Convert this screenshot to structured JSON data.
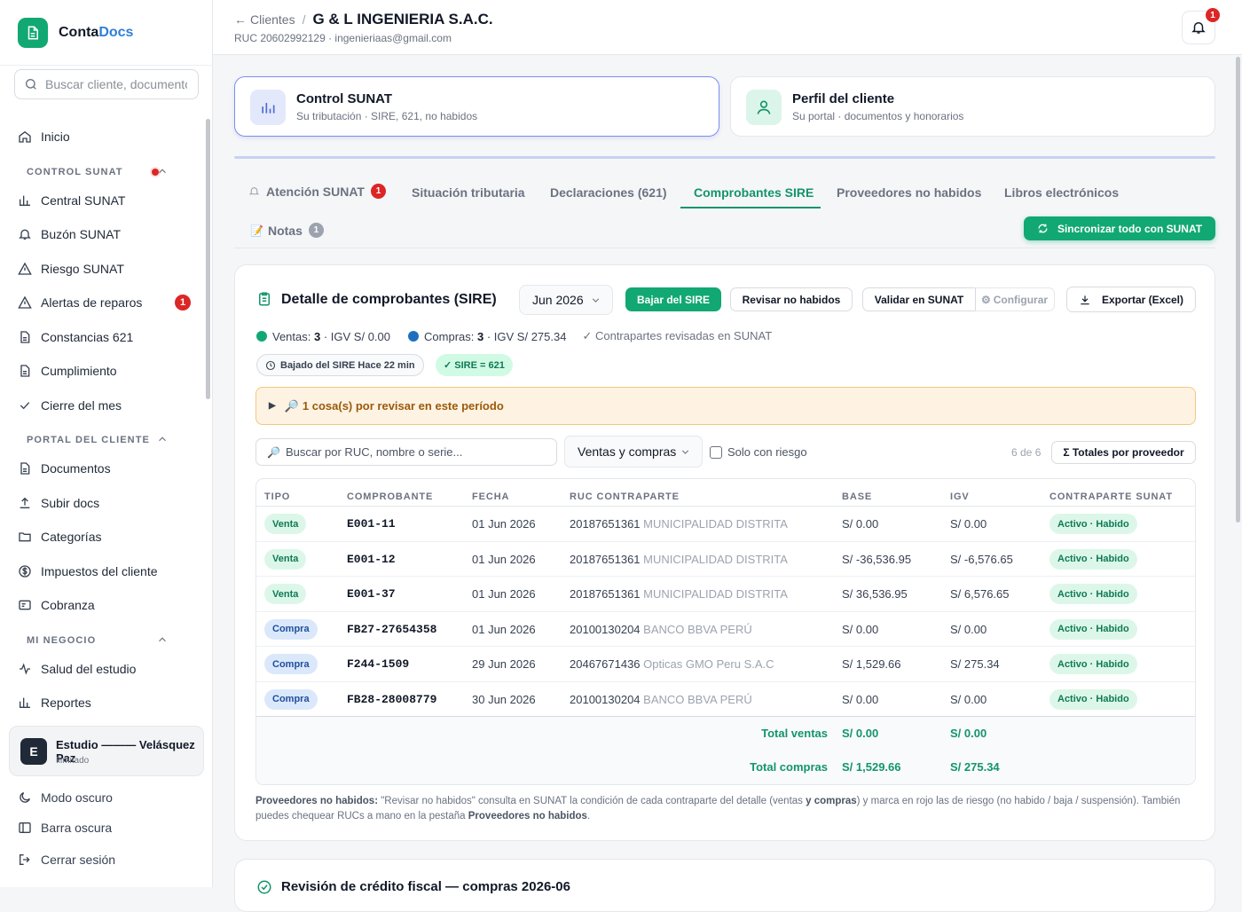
{
  "brand": {
    "name_part1": "Conta",
    "name_part2": "Docs"
  },
  "sidebar": {
    "search_placeholder": "Buscar cliente, documento...",
    "home": "Inicio",
    "section_sunat": "CONTROL SUNAT",
    "sunat_items": [
      "Central SUNAT",
      "Buzón SUNAT",
      "Riesgo SUNAT",
      "Alertas de reparos",
      "Constancias 621",
      "Cumplimiento",
      "Cierre del mes"
    ],
    "alertas_badge": "1",
    "section_portal": "PORTAL DEL CLIENTE",
    "portal_items": [
      "Documentos",
      "Subir docs",
      "Categorías",
      "Impuestos del cliente",
      "Cobranza"
    ],
    "section_negocio": "MI NEGOCIO",
    "negocio_items": [
      "Salud del estudio",
      "Reportes"
    ],
    "studio_initial": "E",
    "studio_name": "Estudio ——— Velásquez Paz",
    "studio_plan": "Ilimitado",
    "footer": [
      "Modo oscuro",
      "Barra oscura",
      "Cerrar sesión"
    ]
  },
  "header": {
    "back_label": "Clientes",
    "client_name": "G & L INGENIERIA S.A.C.",
    "subtitle": "RUC 20602992129 · ingenieriaas@gmail.com",
    "notif_count": "1"
  },
  "cards": [
    {
      "title": "Control SUNAT",
      "subtitle": "Su tributación · SIRE, 621, no habidos"
    },
    {
      "title": "Perfil del cliente",
      "subtitle": "Su portal · documentos y honorarios"
    }
  ],
  "tabs": {
    "atencion": "Atención SUNAT",
    "atencion_badge": "1",
    "situacion": "Situación tributaria",
    "declaraciones": "Declaraciones (621)",
    "comprobantes": "Comprobantes SIRE",
    "proveedores": "Proveedores no habidos",
    "libros": "Libros electrónicos",
    "notas": "Notas",
    "notas_badge": "1",
    "sync_button": "Sincronizar todo con SUNAT"
  },
  "panel": {
    "title": "Detalle de comprobantes (SIRE)",
    "period": "Jun 2026",
    "btn_bajar": "Bajar del SIRE",
    "btn_revisar": "Revisar no habidos",
    "btn_validar": "Validar en SUNAT",
    "btn_configurar": "Configurar",
    "btn_exportar": "Exportar (Excel)",
    "ventas_label": "Ventas:",
    "ventas_count": "3",
    "ventas_igv": "· IGV S/ 0.00",
    "compras_label": "Compras:",
    "compras_count": "3",
    "compras_igv": "· IGV S/ 275.34",
    "revisadas": "✓ Contrapartes revisadas en SUNAT",
    "chip_bajado": "Bajado del SIRE Hace 22 min",
    "chip_sire": "✓ SIRE = 621",
    "alert": "1 cosa(s) por revisar en este período",
    "search_placeholder": "Buscar por RUC, nombre o serie...",
    "filter": "Ventas y compras",
    "risk_label": "Solo con riesgo",
    "count": "6 de 6",
    "totals_btn": "Σ Totales por proveedor",
    "colors": {
      "accent": "#12a873",
      "alert_bg": "#fef3e2",
      "venta": "#dcf7e9",
      "compra": "#dbe8fb"
    }
  },
  "table": {
    "headers": [
      "TIPO",
      "COMPROBANTE",
      "FECHA",
      "RUC CONTRAPARTE",
      "BASE",
      "IGV",
      "CONTRAPARTE SUNAT"
    ],
    "rows": [
      {
        "tipo": "Venta",
        "comp": "E001-11",
        "fecha": "01 Jun 2026",
        "ruc": "20187651361",
        "name": "MUNICIPALIDAD DISTRITA",
        "base": "S/ 0.00",
        "igv": "S/ 0.00",
        "status": "Activo · Habido"
      },
      {
        "tipo": "Venta",
        "comp": "E001-12",
        "fecha": "01 Jun 2026",
        "ruc": "20187651361",
        "name": "MUNICIPALIDAD DISTRITA",
        "base": "S/ -36,536.95",
        "igv": "S/ -6,576.65",
        "status": "Activo · Habido"
      },
      {
        "tipo": "Venta",
        "comp": "E001-37",
        "fecha": "01 Jun 2026",
        "ruc": "20187651361",
        "name": "MUNICIPALIDAD DISTRITA",
        "base": "S/ 36,536.95",
        "igv": "S/ 6,576.65",
        "status": "Activo · Habido"
      },
      {
        "tipo": "Compra",
        "comp": "FB27-27654358",
        "fecha": "01 Jun 2026",
        "ruc": "20100130204",
        "name": "BANCO BBVA PERÚ",
        "base": "S/ 0.00",
        "igv": "S/ 0.00",
        "status": "Activo · Habido"
      },
      {
        "tipo": "Compra",
        "comp": "F244-1509",
        "fecha": "29 Jun 2026",
        "ruc": "20467671436",
        "name": "Opticas GMO Peru S.A.C",
        "base": "S/ 1,529.66",
        "igv": "S/ 275.34",
        "status": "Activo · Habido"
      },
      {
        "tipo": "Compra",
        "comp": "FB28-28008779",
        "fecha": "30 Jun 2026",
        "ruc": "20100130204",
        "name": "BANCO BBVA PERÚ",
        "base": "S/ 0.00",
        "igv": "S/ 0.00",
        "status": "Activo · Habido"
      }
    ],
    "total_ventas_label": "Total ventas",
    "total_ventas_base": "S/ 0.00",
    "total_ventas_igv": "S/ 0.00",
    "total_compras_label": "Total compras",
    "total_compras_base": "S/ 1,529.66",
    "total_compras_igv": "S/ 275.34"
  },
  "footnote": {
    "label": "Proveedores no habidos:",
    "text1": " \"Revisar no habidos\" consulta en SUNAT la condición de cada contraparte del detalle (ventas ",
    "bold1": "y compras",
    "text2": ") y marca en rojo las de riesgo (no habido / baja / suspensión). También puedes chequear RUCs a mano en la pestaña ",
    "bold2": "Proveedores no habidos",
    "text3": "."
  },
  "panel2": {
    "title": "Revisión de crédito fiscal — compras 2026-06"
  }
}
